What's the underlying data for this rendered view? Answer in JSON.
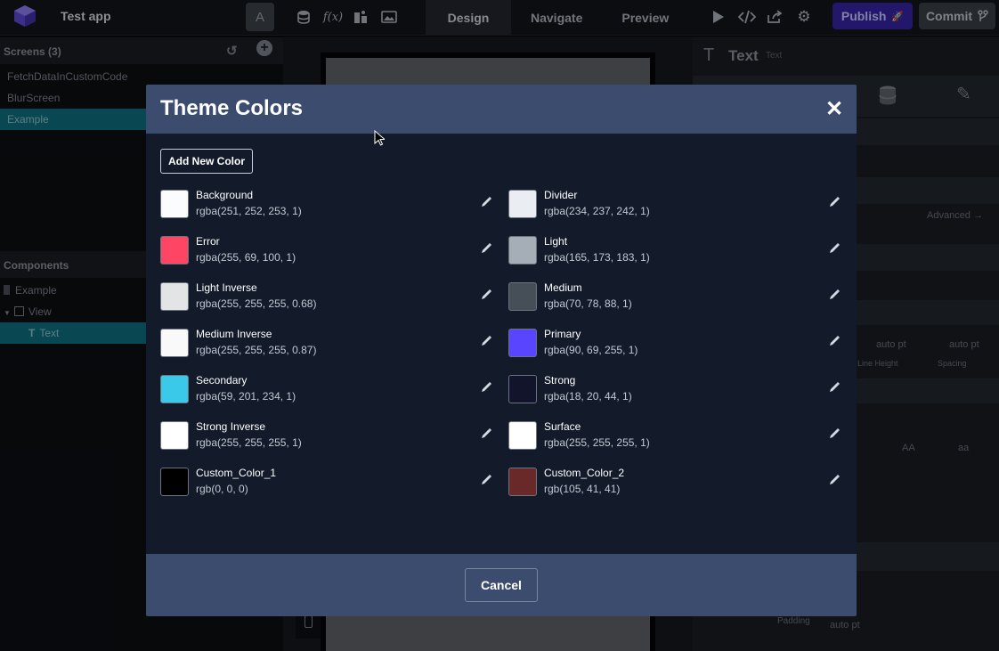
{
  "topbar": {
    "app_title": "Test app",
    "avatar_letter": "A",
    "tabs": [
      {
        "label": "Design",
        "active": true
      },
      {
        "label": "Navigate",
        "active": false
      },
      {
        "label": "Preview",
        "active": false
      }
    ],
    "publish_label": "Publish",
    "commit_label": "Commit"
  },
  "left_panel": {
    "screens_header": "Screens (3)",
    "screens": [
      {
        "label": "FetchDataInCustomCode",
        "active": false
      },
      {
        "label": "BlurScreen",
        "active": false
      },
      {
        "label": "Example",
        "active": true
      }
    ],
    "components_header": "Components",
    "components": [
      {
        "label": "Example"
      },
      {
        "label": "View"
      },
      {
        "label": "Text"
      }
    ]
  },
  "right_panel": {
    "title": "Text",
    "subtitle": "Text",
    "advanced_label": "Advanced →",
    "line_height_label": "Line Height",
    "spacing_label": "Spacing",
    "padding_label": "Padding",
    "auto_pt": "auto pt",
    "case_upper": "AA",
    "case_lower": "aa"
  },
  "modal": {
    "title": "Theme Colors",
    "add_button": "Add New Color",
    "cancel_button": "Cancel",
    "colors_left": [
      {
        "name": "Background",
        "value": "rgba(251, 252, 253, 1)",
        "swatch": "#fbfcfd"
      },
      {
        "name": "Error",
        "value": "rgba(255, 69, 100, 1)",
        "swatch": "#ff4564"
      },
      {
        "name": "Light Inverse",
        "value": "rgba(255, 255, 255, 0.68)",
        "swatch": "#e3e4e6"
      },
      {
        "name": "Medium Inverse",
        "value": "rgba(255, 255, 255, 0.87)",
        "swatch": "#f9f9fa"
      },
      {
        "name": "Secondary",
        "value": "rgba(59, 201, 234, 1)",
        "swatch": "#3bc9ea"
      },
      {
        "name": "Strong Inverse",
        "value": "rgba(255, 255, 255, 1)",
        "swatch": "#ffffff"
      },
      {
        "name": "Custom_Color_1",
        "value": "rgb(0, 0, 0)",
        "swatch": "#000000"
      }
    ],
    "colors_right": [
      {
        "name": "Divider",
        "value": "rgba(234, 237, 242, 1)",
        "swatch": "#eaedf2"
      },
      {
        "name": "Light",
        "value": "rgba(165, 173, 183, 1)",
        "swatch": "#a5adb7"
      },
      {
        "name": "Medium",
        "value": "rgba(70, 78, 88, 1)",
        "swatch": "#464e58"
      },
      {
        "name": "Primary",
        "value": "rgba(90, 69, 255, 1)",
        "swatch": "#5a45ff"
      },
      {
        "name": "Strong",
        "value": "rgba(18, 20, 44, 1)",
        "swatch": "#12142c"
      },
      {
        "name": "Surface",
        "value": "rgba(255, 255, 255, 1)",
        "swatch": "#ffffff"
      },
      {
        "name": "Custom_Color_2",
        "value": "rgb(105, 41, 41)",
        "swatch": "#692929"
      }
    ]
  }
}
